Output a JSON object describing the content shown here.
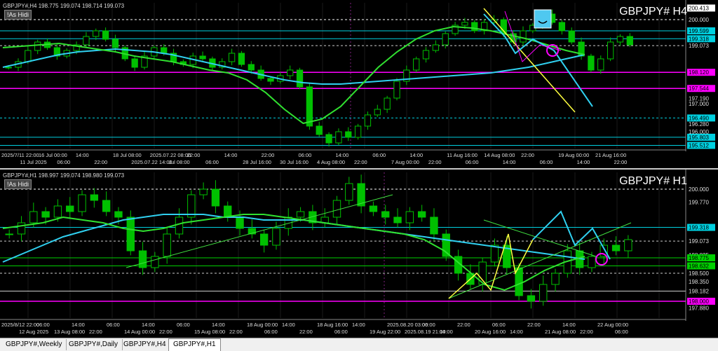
{
  "chart_data": [
    {
      "type": "candlestick",
      "symbol_title": "GBPJPY#  H4",
      "info": "GBPJPY#,H4  198.775 199.074 198.714 199.073",
      "button": "!As Hidi",
      "ylim": [
        195.4,
        200.6
      ],
      "price_labels": [
        "200.413",
        "200.000",
        "199.599",
        "199.318",
        "199.073",
        "198.120",
        "197.544",
        "197.190",
        "197.000",
        "196.490",
        "196.280",
        "196.000",
        "195.803",
        "195.512"
      ],
      "label_colors": {
        "200.413": "#ffffff",
        "199.599": "#00d0e0",
        "199.318": "#00d0e0",
        "198.120": "#ff00ff",
        "197.544": "#ff00ff",
        "196.490": "#00d0e0",
        "195.803": "#00d0e0",
        "195.512": "#00d0e0"
      },
      "hlines": [
        {
          "y": 200.0,
          "color": "#ffffff",
          "dash": true
        },
        {
          "y": 199.599,
          "color": "#00d0e0",
          "dash": false
        },
        {
          "y": 199.318,
          "color": "#00d0e0",
          "dash": false
        },
        {
          "y": 199.073,
          "color": "#cccccc",
          "dash": true
        },
        {
          "y": 198.12,
          "color": "#ff00ff",
          "dash": false
        },
        {
          "y": 197.544,
          "color": "#ff00ff",
          "dash": false
        },
        {
          "y": 196.49,
          "color": "#00d0e0",
          "dash": true
        },
        {
          "y": 195.803,
          "color": "#00d0e0",
          "dash": false
        },
        {
          "y": 195.512,
          "color": "#00d0e0",
          "dash": false
        }
      ],
      "time_labels": [
        "2025/7/11 22:00",
        "11 Jul 2025",
        "16 Jul 00:00",
        "06:00",
        "14:00",
        "22:00",
        "18 Jul 08:00",
        "2025.07.22 14:00",
        "2025.07.22 08:00",
        "Jul 08:00",
        "22:00",
        "06:00",
        "14:00",
        "28 Jul 16:00",
        "22:00",
        "30 Jul 16:00",
        "06:00",
        "4 Aug 08:00",
        "14:00",
        "22:00",
        "06:00",
        "7 Aug 00:00",
        "14:00",
        "22:00",
        "11 Aug 16:00",
        "06:00",
        "14 Aug 08:00",
        "14:00",
        "22:00",
        "06:00",
        "19 Aug 00:00",
        "14:00",
        "21 Aug 16:00",
        "22:00"
      ],
      "close_series": [
        198.3,
        198.5,
        198.9,
        199.2,
        199.0,
        198.7,
        198.9,
        199.1,
        199.4,
        199.6,
        199.3,
        199.0,
        198.6,
        198.3,
        198.7,
        199.0,
        198.8,
        198.5,
        198.4,
        198.7,
        198.6,
        198.3,
        198.5,
        198.8,
        198.4,
        198.2,
        197.9,
        197.8,
        198.0,
        198.2,
        197.6,
        196.2,
        195.9,
        195.6,
        196.0,
        195.8,
        196.2,
        196.6,
        196.8,
        197.2,
        197.8,
        198.2,
        198.6,
        198.9,
        199.1,
        199.5,
        199.8,
        199.9,
        199.6,
        199.9,
        200.0,
        199.5,
        199.2,
        199.6,
        199.8,
        200.2,
        199.9,
        199.6,
        199.2,
        198.7,
        198.2,
        198.6,
        199.2,
        199.4,
        199.1
      ],
      "ma_green": [
        199.0,
        199.05,
        199.1,
        199.15,
        199.05,
        198.95,
        198.85,
        198.7,
        198.6,
        198.5,
        198.35,
        198.2,
        198.1,
        197.85,
        197.4,
        196.8,
        196.3,
        196.45,
        196.9,
        197.6,
        198.3,
        198.85,
        199.3,
        199.6,
        199.75,
        199.7,
        199.6,
        199.45,
        199.3,
        199.1,
        198.9,
        198.75
      ],
      "ma_cyan": [
        198.3,
        198.45,
        198.6,
        198.75,
        198.85,
        198.9,
        198.95,
        198.9,
        198.85,
        198.75,
        198.6,
        198.45,
        198.3,
        198.15,
        198.0,
        197.85,
        197.75,
        197.7,
        197.7,
        197.75,
        197.8,
        197.85,
        197.9,
        197.95,
        198.0,
        198.05,
        198.1,
        198.2,
        198.3,
        198.45,
        198.6,
        198.75
      ],
      "yellow_line": [
        [
          690,
          200.4
        ],
        [
          820,
          196.7
        ]
      ],
      "cyan_projection": [
        [
          690,
          200.2
        ],
        [
          720,
          199.4
        ],
        [
          735,
          198.8
        ],
        [
          760,
          199.3
        ],
        [
          790,
          198.9
        ],
        [
          845,
          196.9
        ]
      ],
      "magenta_zigzag": [
        [
          720,
          200.3
        ],
        [
          745,
          198.5
        ],
        [
          770,
          199.1
        ],
        [
          800,
          198.9
        ]
      ]
    },
    {
      "type": "candlestick",
      "symbol_title": "GBPJPY#  H1",
      "info": "GBPJPY#,H1  198.997 199.074 198.980 199.073",
      "button": "!As Hidi",
      "ylim": [
        197.7,
        200.3
      ],
      "price_labels": [
        "200.000",
        "199.770",
        "199.318",
        "199.073",
        "198.825",
        "198.775",
        "198.632",
        "198.500",
        "198.350",
        "198.182",
        "198.000",
        "197.880"
      ],
      "label_colors": {
        "199.318": "#00d0e0",
        "198.775": "#00d000",
        "198.632": "#00d000",
        "198.000": "#ff00ff"
      },
      "hlines": [
        {
          "y": 200.0,
          "color": "#ffffff",
          "dash": true
        },
        {
          "y": 199.318,
          "color": "#00d0e0",
          "dash": false
        },
        {
          "y": 199.073,
          "color": "#cccccc",
          "dash": true
        },
        {
          "y": 198.775,
          "color": "#00d000",
          "dash": false
        },
        {
          "y": 198.632,
          "color": "#00d000",
          "dash": false
        },
        {
          "y": 198.5,
          "color": "#cccccc",
          "dash": true
        },
        {
          "y": 198.182,
          "color": "#cccccc",
          "dash": false
        },
        {
          "y": 198.0,
          "color": "#ff00ff",
          "dash": false
        }
      ],
      "time_labels": [
        "2025/8/12 22:00",
        "12 Aug 2025",
        "06:00",
        "13 Aug 08:00",
        "14:00",
        "22:00",
        "06:00",
        "14 Aug 00:00",
        "14:00",
        "22:00",
        "06:00",
        "15 Aug 08:00",
        "14:00",
        "22:00",
        "18 Aug 00:00",
        "06:00",
        "14:00",
        "22:00",
        "18 Aug 16:00",
        "06:00",
        "14:00",
        "19 Aug 22:00",
        "2025.08.20 03:00",
        "2025.08.19 21:00",
        "06:00",
        "14:00",
        "22:00",
        "20 Aug 16:00",
        "06:00",
        "14:00",
        "22:00",
        "21 Aug 08:00",
        "14:00",
        "22:00",
        "22 Aug 00:00",
        "06:00"
      ],
      "close_series": [
        199.2,
        199.4,
        199.6,
        199.5,
        199.7,
        199.6,
        199.9,
        199.8,
        199.6,
        199.5,
        198.9,
        198.6,
        198.8,
        199.2,
        199.5,
        199.9,
        200.0,
        199.7,
        199.5,
        199.3,
        199.2,
        199.0,
        199.3,
        199.5,
        199.6,
        199.4,
        199.5,
        199.8,
        200.1,
        199.7,
        199.6,
        199.5,
        199.4,
        199.6,
        199.5,
        199.2,
        198.8,
        198.5,
        198.3,
        198.7,
        199.0,
        198.6,
        198.1,
        198.0,
        198.3,
        198.5,
        198.9,
        198.6,
        198.8,
        199.0,
        198.9,
        199.1
      ],
      "ma_green": [
        199.3,
        199.35,
        199.4,
        199.5,
        199.45,
        199.4,
        199.3,
        199.25,
        199.3,
        199.4,
        199.45,
        199.5,
        199.55,
        199.55,
        199.5,
        199.45,
        199.4,
        199.35,
        199.3,
        199.25,
        199.2,
        199.1,
        198.9,
        198.6,
        198.3,
        198.2,
        198.35,
        198.55,
        198.7,
        198.8
      ],
      "ma_cyan": [
        198.7,
        198.85,
        199.0,
        199.15,
        199.25,
        199.35,
        199.45,
        199.5,
        199.55,
        199.55,
        199.55,
        199.5,
        199.5,
        199.45,
        199.45,
        199.45,
        199.4,
        199.35,
        199.3,
        199.25,
        199.2,
        199.15,
        199.1,
        199.05,
        199.0,
        198.95,
        198.9,
        198.85,
        198.8,
        198.75
      ],
      "green_trend1": [
        [
          180,
          198.6
        ],
        [
          560,
          199.9
        ]
      ],
      "green_trend2": [
        [
          640,
          198.05
        ],
        [
          900,
          199.4
        ]
      ],
      "green_trend3": [
        [
          690,
          199.45
        ],
        [
          850,
          198.8
        ]
      ],
      "yellow_zigzag": [
        [
          640,
          198.05
        ],
        [
          680,
          198.5
        ],
        [
          700,
          198.2
        ],
        [
          725,
          199.2
        ],
        [
          735,
          198.5
        ],
        [
          760,
          199.1
        ]
      ],
      "cyan_projection": [
        [
          760,
          199.1
        ],
        [
          800,
          199.6
        ],
        [
          820,
          199.0
        ],
        [
          845,
          199.3
        ],
        [
          870,
          198.75
        ]
      ]
    }
  ],
  "tabs": [
    "GBPJPY#,Weekly",
    "GBPJPY#,Daily",
    "GBPJPY#,H4",
    "GBPJPY#,H1"
  ],
  "active_tab": 3,
  "colors": {
    "bull": "#00d000",
    "bear": "#00d000",
    "bg": "#000000",
    "ma_green": "#30e030",
    "ma_cyan": "#30d0f0",
    "yellow": "#ffff40",
    "magenta": "#ff00ff"
  }
}
